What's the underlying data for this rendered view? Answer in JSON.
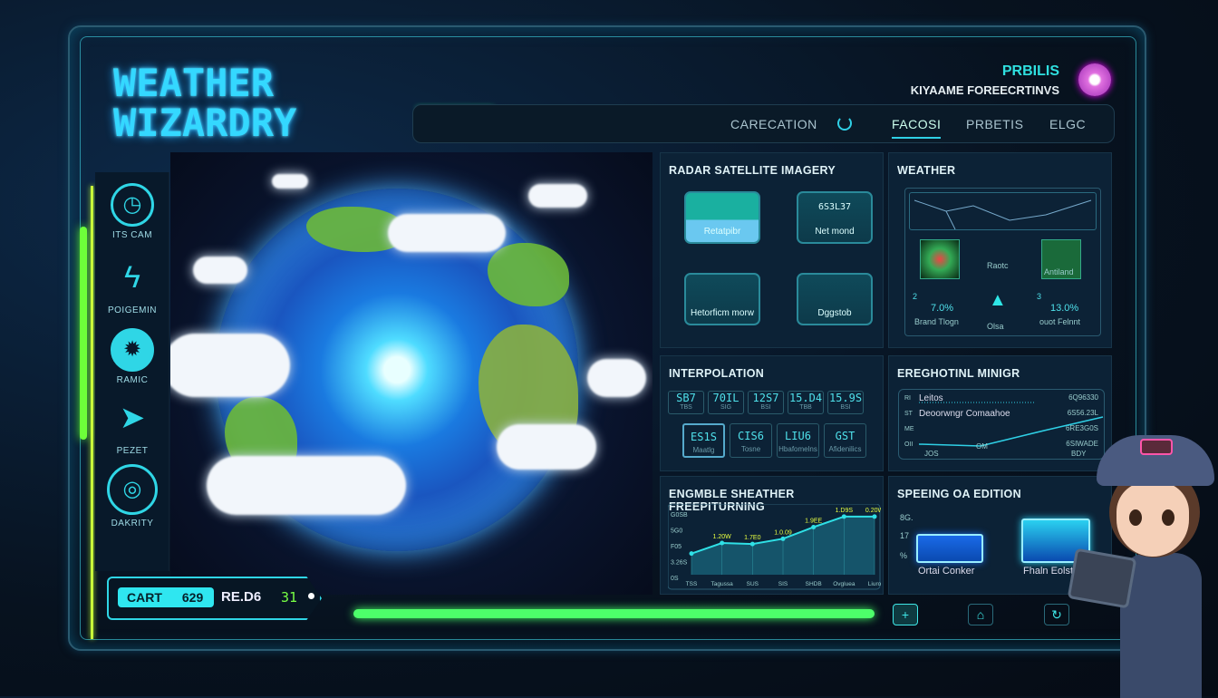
{
  "title": {
    "line1": "WEATHER",
    "line2": "WIZARDRY"
  },
  "brand": {
    "name": "PRBILIS",
    "subtitle": "KIYAAME FOREECRTINVS",
    "avatar_icon": "flower-icon"
  },
  "nav": {
    "tabs": [
      {
        "label": "CARECATION"
      },
      {
        "label": "FACOSI",
        "active": true
      },
      {
        "label": "PRBETIS"
      },
      {
        "label": "ELGC"
      }
    ],
    "loading_icon": "spinner-icon"
  },
  "sidebar": {
    "items": [
      {
        "label": "ITS CAM",
        "icon": "compass-icon"
      },
      {
        "label": "POIGEMIN",
        "icon": "storm-icon"
      },
      {
        "label": "RAMIC",
        "icon": "gear-icon"
      },
      {
        "label": "PEZET",
        "icon": "plane-icon"
      },
      {
        "label": "DAKRITY",
        "icon": "dial-icon"
      }
    ]
  },
  "radar": {
    "title": "RADAR SATELLITE IMAGERY",
    "cards": [
      {
        "value": "",
        "label": "Retatpibr"
      },
      {
        "value": "6S3L37",
        "label": "Net mond"
      },
      {
        "value": "",
        "label": "Hetorficm morw"
      },
      {
        "value": "",
        "label": "Dggstob"
      }
    ]
  },
  "weather": {
    "title": "WEATHER",
    "mid_label": "Raotc",
    "left": {
      "num": "2",
      "pct": "7.0%",
      "label": "Brand Tlogn"
    },
    "center_label": "Olsa",
    "right": {
      "num": "3",
      "pct": "13.0%",
      "label": "ouot Felnnt"
    },
    "thumb_right": "Antiland"
  },
  "interpolation": {
    "title": "INTERPOLATION",
    "row1": [
      {
        "v": "SB7",
        "s": "TBS"
      },
      {
        "v": "70IL",
        "s": "SIG"
      },
      {
        "v": "12S7",
        "s": "BSI"
      },
      {
        "v": "15.D4",
        "s": "TBB"
      },
      {
        "v": "15.9S",
        "s": "BSI"
      }
    ],
    "row2": [
      {
        "v": "ES1S",
        "s": "Maatlg"
      },
      {
        "v": "CIS6",
        "s": "Tosne"
      },
      {
        "v": "LIU6",
        "s": "Hbafomelns"
      },
      {
        "v": "GST",
        "s": "Afidenilics"
      }
    ]
  },
  "emotional": {
    "title": "EREGHOTINL MINIGR",
    "rows": [
      {
        "axis": "RI",
        "label": "Leitos",
        "value": "6Q96330"
      },
      {
        "axis": "ST",
        "label": "Deoorwngr Comaahoe",
        "value": "6S56.23L"
      },
      {
        "axis": "ME",
        "label": "",
        "value": "6RE3G0S"
      },
      {
        "axis": "OII",
        "label": "",
        "value": "6SIWADE"
      }
    ],
    "x_ticks": [
      "JOS",
      "OM",
      "BDY"
    ]
  },
  "chart_data": {
    "type": "area",
    "title": "ENGMBLE SHEATHER FREEPITURNING",
    "y_ticks": [
      "G0SB",
      "5G0",
      "F05",
      "3.26S",
      "0S"
    ],
    "x_ticks": [
      "TSS",
      "Tagussa",
      "SUS",
      "SIS",
      "SHDB",
      "Ovgluea",
      "Liuro"
    ],
    "values": [
      2.0,
      3.0,
      2.9,
      3.4,
      4.5,
      5.5,
      5.5
    ],
    "point_labels": [
      "",
      "1.20W",
      "1.7E0",
      "1.0.09",
      "1.9EE",
      "1.D9S",
      "0.20W"
    ],
    "ylim": [
      0,
      6
    ],
    "color": "#2fe0e6"
  },
  "speeding": {
    "title": "SPEEING OA EDITION",
    "y_ticks": [
      "8G.",
      "17",
      "%"
    ],
    "bars": [
      {
        "label": "Ortai Conker",
        "level": 0.45,
        "color": "#1a6ae8"
      },
      {
        "label": "Fhaln Eolst",
        "level": 0.7,
        "color": "#2ad0f0"
      }
    ]
  },
  "cart": {
    "label": "CART",
    "value": "629",
    "label2": "RE.D6",
    "count": "31"
  },
  "progress": {
    "value": 100,
    "color": "#4dff6a"
  },
  "bottom_buttons": [
    {
      "icon": "plus-icon",
      "glyph": "+"
    },
    {
      "icon": "home-icon",
      "glyph": "⌂"
    },
    {
      "icon": "refresh-icon",
      "glyph": "↻"
    }
  ]
}
